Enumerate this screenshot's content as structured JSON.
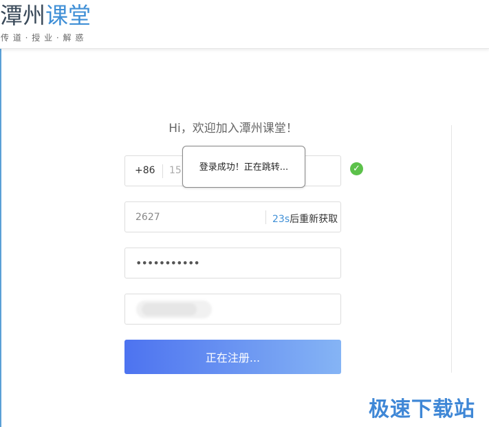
{
  "header": {
    "logo_title_part1": "潭州",
    "logo_title_part2": "课堂",
    "logo_subtitle": "传 道 · 授 业 · 解 惑"
  },
  "form": {
    "welcome": "Hi，欢迎加入潭州课堂！",
    "phone_prefix": "+86",
    "phone_value": "15(",
    "code_value": "2627",
    "resend_seconds": "23s",
    "resend_text": "后重新获取",
    "password_value": "•••••••••••",
    "submit_label": "正在注册..."
  },
  "toast": {
    "message": "登录成功！正在跳转..."
  },
  "status": {
    "phone_valid_icon": "check-circle-icon"
  },
  "watermark": {
    "text": "极速下载站"
  },
  "colors": {
    "accent": "#3f8fd6",
    "button_gradient_start": "#4d73f0",
    "button_gradient_end": "#85b4f5",
    "success": "#5cc14a"
  }
}
